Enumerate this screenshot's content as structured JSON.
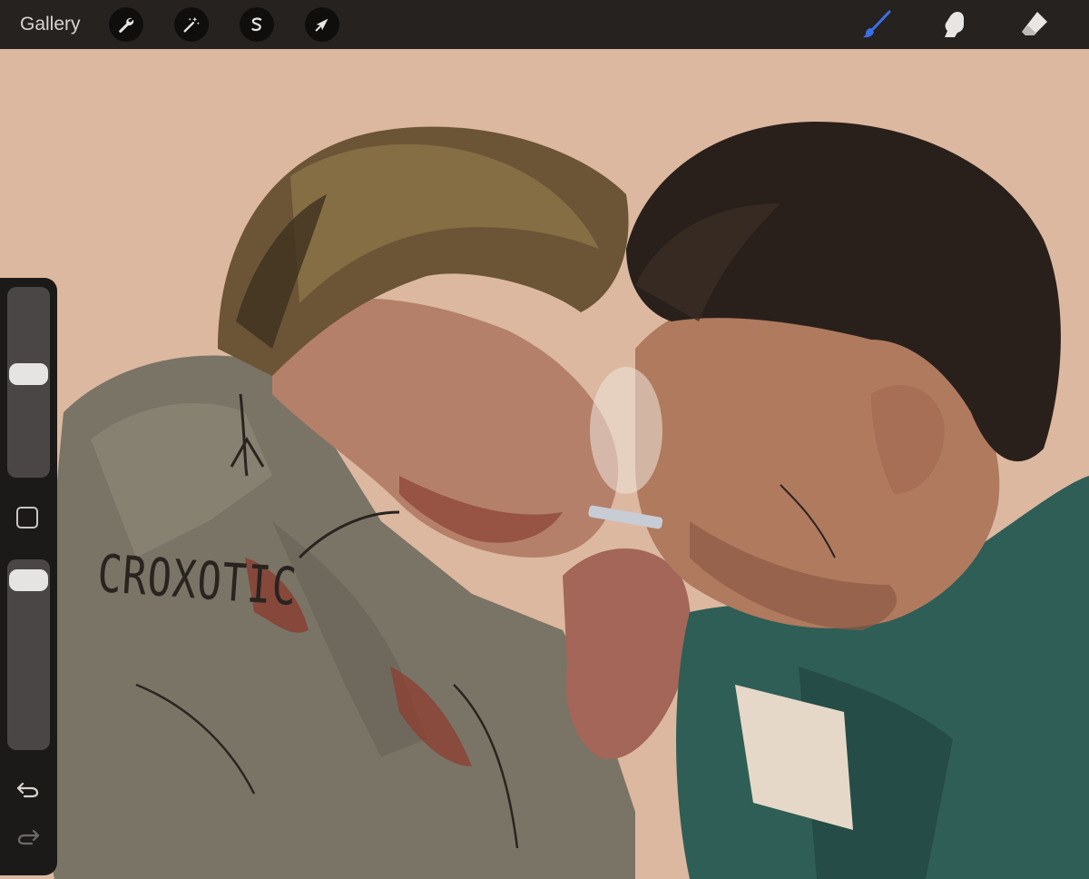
{
  "topbar": {
    "gallery_label": "Gallery",
    "left_tools": [
      {
        "name": "actions",
        "icon": "wrench-icon"
      },
      {
        "name": "adjustments",
        "icon": "magic-wand-icon"
      },
      {
        "name": "selection",
        "icon": "s-selection-icon"
      },
      {
        "name": "transform",
        "icon": "arrow-cursor-icon"
      }
    ],
    "right_tools": [
      {
        "name": "brush",
        "icon": "brush-icon",
        "active": true
      },
      {
        "name": "smudge",
        "icon": "smudge-finger-icon",
        "active": false
      },
      {
        "name": "eraser",
        "icon": "eraser-icon",
        "active": false
      }
    ]
  },
  "canvas": {
    "signature_text": "CROXOTIC",
    "background_color": "#dcb8a0"
  },
  "sidebar": {
    "brush_size_level": 0.55,
    "opacity_level": 0.95,
    "modifier_icon": "square-icon",
    "undo_icon": "undo-icon",
    "redo_icon": "redo-icon"
  },
  "colors": {
    "toolbar_bg": "#262220",
    "active_tool": "#3b6fe8",
    "sidebar_bg": "#1c1a19"
  }
}
